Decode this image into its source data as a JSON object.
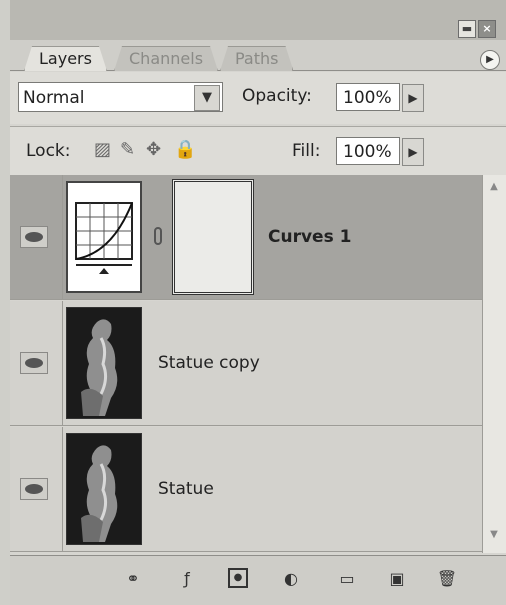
{
  "panel": {
    "tabs": [
      {
        "label": "Layers",
        "active": true
      },
      {
        "label": "Channels",
        "active": false
      },
      {
        "label": "Paths",
        "active": false
      }
    ],
    "menu_icon": "triangle-right-icon"
  },
  "options": {
    "blend_mode": "Normal",
    "opacity_label": "Opacity:",
    "opacity_value": "100%",
    "lock_label": "Lock:",
    "fill_label": "Fill:",
    "fill_value": "100%"
  },
  "layers": [
    {
      "name": "Curves 1",
      "type": "adjustment",
      "selected": true,
      "visible": true
    },
    {
      "name": "Statue copy",
      "type": "image",
      "selected": false,
      "visible": true
    },
    {
      "name": "Statue",
      "type": "image",
      "selected": false,
      "visible": true
    }
  ],
  "bottom_icons": [
    "link-icon",
    "layer-style-icon",
    "layer-mask-icon",
    "adjustment-layer-icon",
    "folder-icon",
    "new-layer-icon",
    "trash-icon"
  ]
}
